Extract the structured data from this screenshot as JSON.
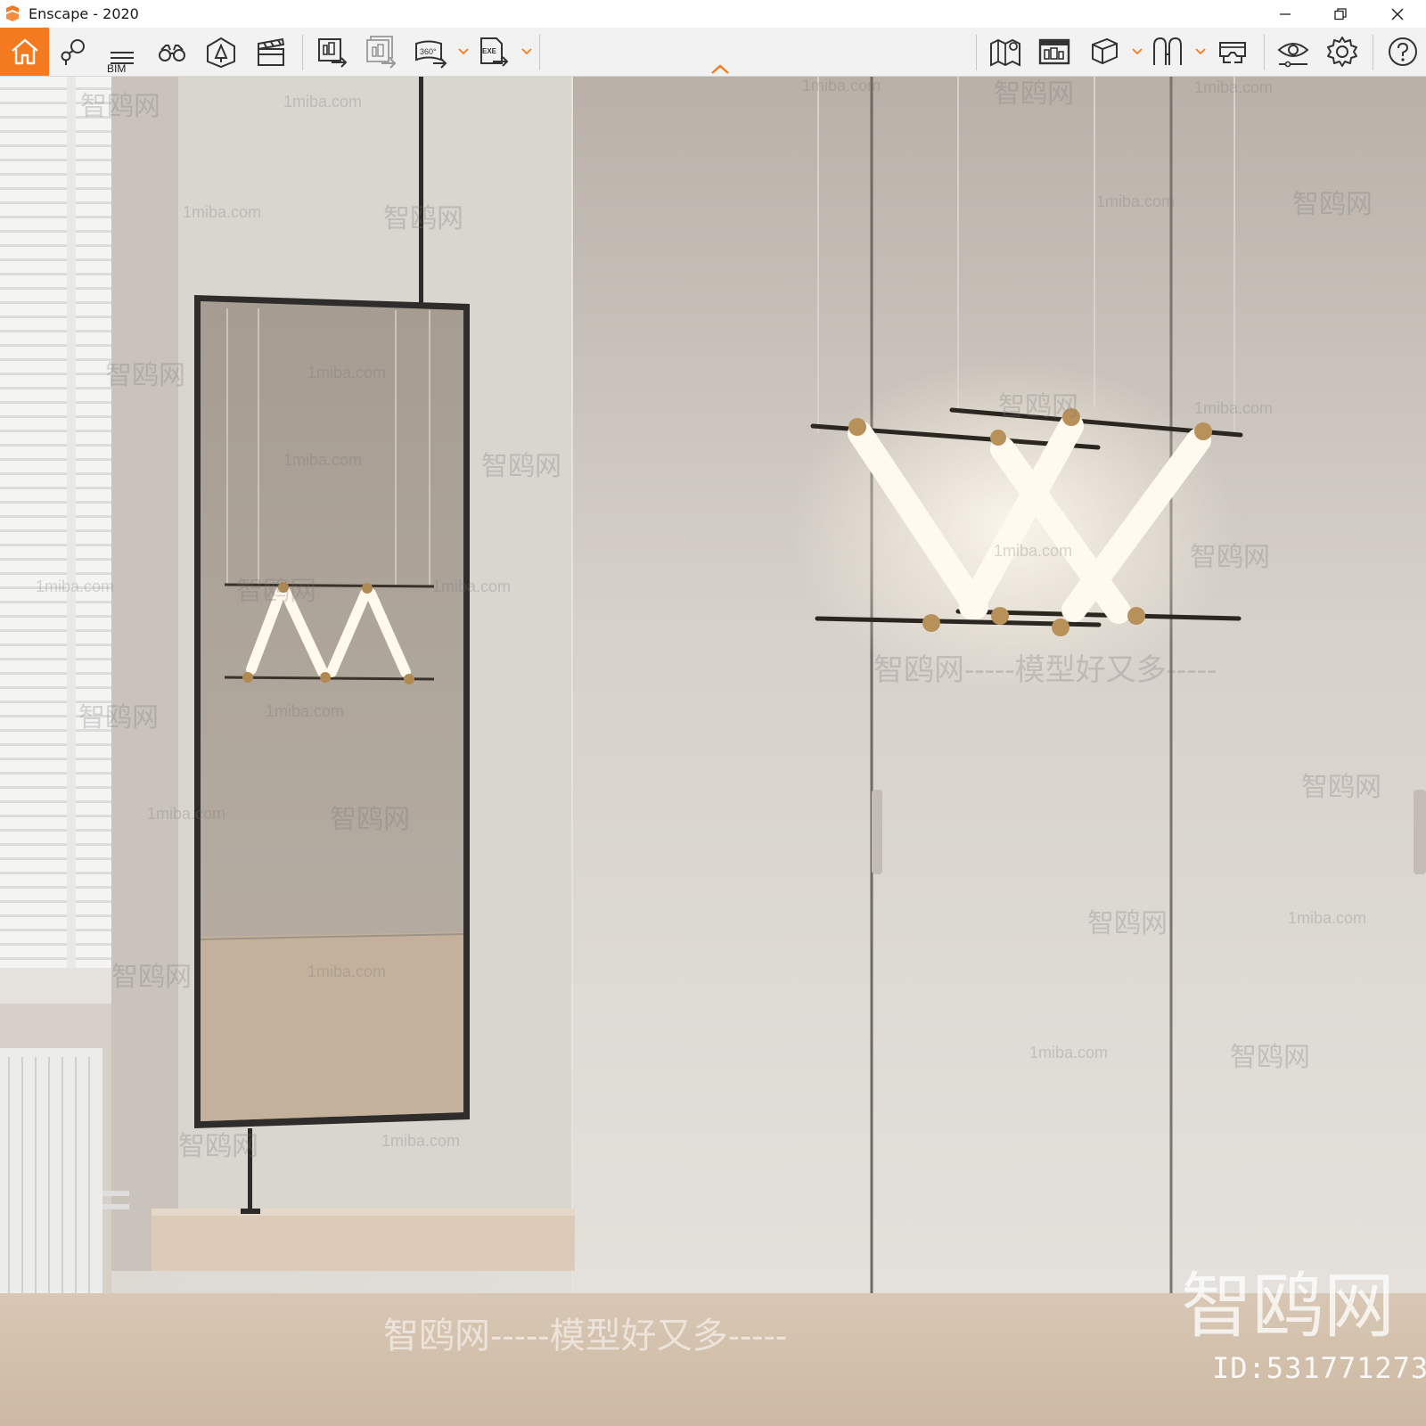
{
  "window": {
    "title": "Enscape - 2020"
  },
  "toolbar": {
    "bim_label": "BIM",
    "items": [
      "home-icon",
      "location-pin-icon",
      "bim-list-icon",
      "binoculars-icon",
      "assets-house-icon",
      "clapperboard-icon",
      "screenshot-export-icon",
      "batch-render-icon",
      "panorama-360-icon",
      "exe-export-icon",
      "map-pin-icon",
      "web-standalone-icon",
      "cube-view-icon",
      "vr-headset-outline-icon",
      "vr-mode-icon",
      "eye-visual-settings-icon",
      "gear-icon",
      "help-icon"
    ]
  },
  "viewport": {
    "watermarks": {
      "site": "1miba.com",
      "brand": "智鸥网",
      "slogan": "智鸥网-----模型好又多-----",
      "corner_logo": "智鸥网",
      "id": "ID:531771273"
    }
  },
  "colors": {
    "accent": "#f47a20",
    "toolbar_bg": "#f2f2f2"
  }
}
